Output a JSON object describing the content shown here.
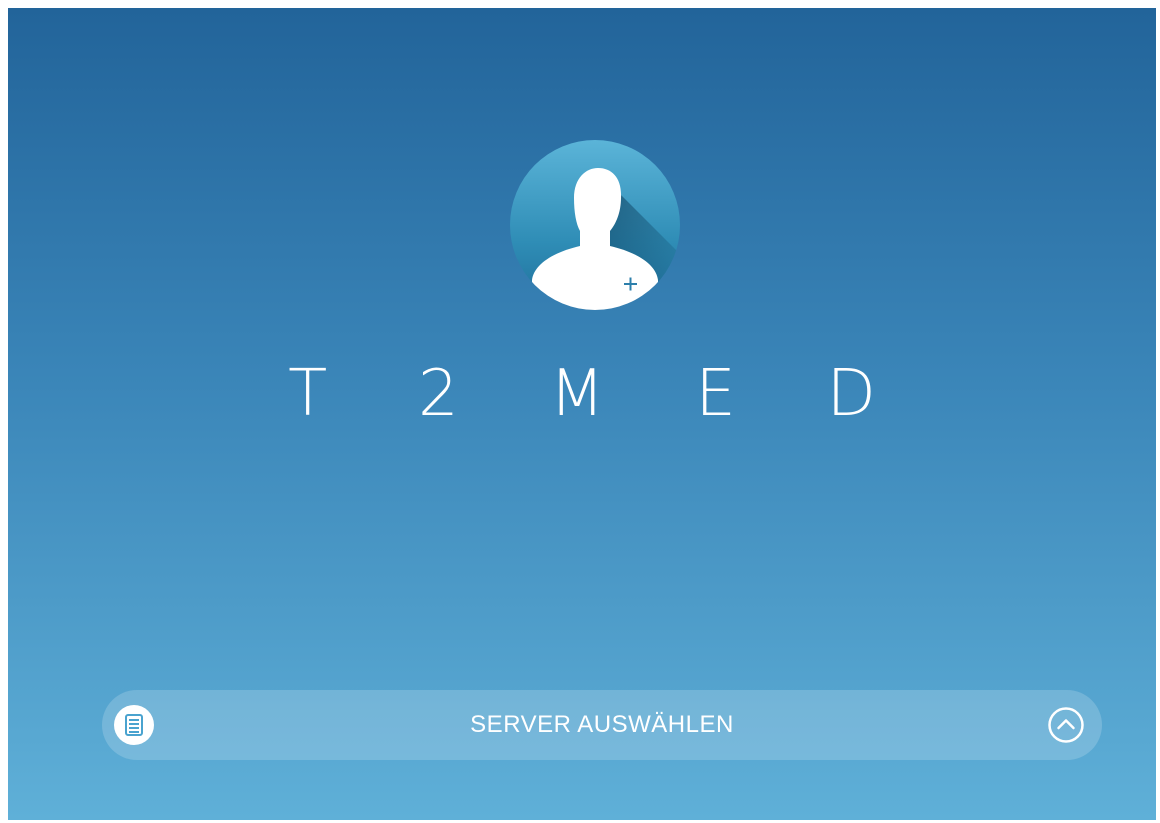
{
  "app": {
    "brand": "T2MED",
    "brand_display": "T 2 M E D"
  },
  "avatar": {
    "icon": "user-plus-icon",
    "accent_colors": [
      "#1f6f9a",
      "#4fb1d6"
    ]
  },
  "server_selector": {
    "label": "SERVER AUSWÄHLEN",
    "left_icon": "server-list-icon",
    "right_icon": "chevron-up-circle-icon"
  },
  "colors": {
    "background_top": "#22649a",
    "background_bottom": "#5fb0d8",
    "text": "#ffffff"
  }
}
